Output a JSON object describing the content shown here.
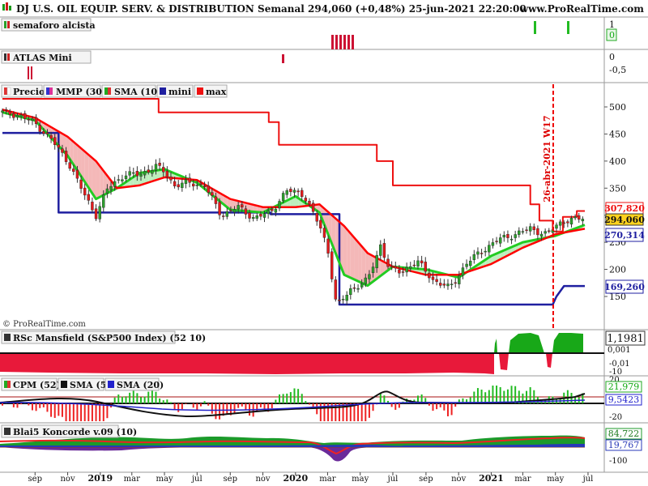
{
  "header": {
    "title": "DJ U.S. OIL EQUIP. SERV. & DISTRIBUTION Semanal 294,060 (+0,48%) 25-jun-2021 22:20:00",
    "site": "www.ProRealTime.com"
  },
  "watermark": "© ProRealTime.com",
  "colors": {
    "candle_up": "#2ca02c",
    "candle_down": "#e41a1c",
    "mmp": "#ff0000",
    "sma": "#22cc22",
    "mini": "#1f1fa0",
    "max": "#ee1111",
    "fill_red": "#f4b8b8",
    "fill_green": "#bdeebd",
    "mansfield_red": "#e8193a",
    "mansfield_green": "#18a818",
    "vline": "#ee0000"
  },
  "chart_data": [
    {
      "id": "semaforo",
      "type": "bar",
      "title": "semaforo alcista",
      "ylim": [
        0,
        1
      ],
      "yticks": [
        "1",
        "0"
      ],
      "current_label": "0",
      "green_signals": [
        "2021-03-15",
        "2021-05-10"
      ],
      "red_signals_panel_atlas": [
        "2020-01-27",
        "2020-02-10",
        "2020-02-24",
        "2020-03-09",
        "2020-03-23",
        "2020-04-06"
      ]
    },
    {
      "id": "atlas",
      "type": "bar",
      "title": "ATLAS Mini",
      "yticks": [
        "0",
        "-0,5"
      ],
      "red_bars": [
        "2018-08-06",
        "2018-08-13",
        "2019-11-25"
      ]
    },
    {
      "id": "price",
      "type": "line",
      "legend": [
        "Precio",
        "MMP (30)",
        "SMA (10)",
        "mini",
        "max"
      ],
      "ylim": [
        110,
        540
      ],
      "yticks": [
        500,
        450,
        400,
        350,
        300,
        250,
        200,
        150
      ],
      "x_ticks": [
        "sep",
        "nov",
        "2019",
        "mar",
        "may",
        "jul",
        "sep",
        "nov",
        "2020",
        "mar",
        "may",
        "jul",
        "sep",
        "nov",
        "2021",
        "mar",
        "may",
        "jul"
      ],
      "value_labels": [
        "307,820",
        "294,060",
        "270,314",
        "169,260"
      ],
      "vline": {
        "date": "2021-04-26",
        "label": "26-abr-2021 W17"
      },
      "close": [
        [
          "2018-07-02",
          490
        ],
        [
          "2018-08-01",
          485
        ],
        [
          "2018-09-01",
          470
        ],
        [
          "2018-10-01",
          440
        ],
        [
          "2018-11-01",
          400
        ],
        [
          "2018-12-01",
          340
        ],
        [
          "2018-12-24",
          300
        ],
        [
          "2019-01-15",
          350
        ],
        [
          "2019-02-15",
          375
        ],
        [
          "2019-03-15",
          375
        ],
        [
          "2019-04-15",
          390
        ],
        [
          "2019-05-01",
          380
        ],
        [
          "2019-05-20",
          355
        ],
        [
          "2019-06-15",
          360
        ],
        [
          "2019-07-15",
          355
        ],
        [
          "2019-08-15",
          300
        ],
        [
          "2019-09-15",
          315
        ],
        [
          "2019-10-15",
          295
        ],
        [
          "2019-11-15",
          305
        ],
        [
          "2019-12-15",
          345
        ],
        [
          "2020-01-15",
          340
        ],
        [
          "2020-02-15",
          280
        ],
        [
          "2020-03-01",
          240
        ],
        [
          "2020-03-18",
          130
        ],
        [
          "2020-04-15",
          165
        ],
        [
          "2020-05-15",
          180
        ],
        [
          "2020-06-08",
          245
        ],
        [
          "2020-06-25",
          200
        ],
        [
          "2020-07-15",
          195
        ],
        [
          "2020-08-15",
          215
        ],
        [
          "2020-09-15",
          180
        ],
        [
          "2020-10-15",
          165
        ],
        [
          "2020-11-15",
          210
        ],
        [
          "2020-12-15",
          235
        ],
        [
          "2021-01-15",
          255
        ],
        [
          "2021-02-15",
          265
        ],
        [
          "2021-03-15",
          275
        ],
        [
          "2021-04-15",
          265
        ],
        [
          "2021-05-15",
          290
        ],
        [
          "2021-06-25",
          294.06
        ]
      ],
      "mmp": [
        [
          "2018-07-02",
          495
        ],
        [
          "2018-09-01",
          480
        ],
        [
          "2018-11-01",
          445
        ],
        [
          "2018-12-24",
          400
        ],
        [
          "2019-02-01",
          350
        ],
        [
          "2019-03-15",
          355
        ],
        [
          "2019-05-01",
          370
        ],
        [
          "2019-07-01",
          365
        ],
        [
          "2019-09-01",
          330
        ],
        [
          "2019-11-01",
          315
        ],
        [
          "2020-01-01",
          315
        ],
        [
          "2020-02-15",
          320
        ],
        [
          "2020-04-01",
          280
        ],
        [
          "2020-05-15",
          230
        ],
        [
          "2020-07-01",
          205
        ],
        [
          "2020-09-01",
          190
        ],
        [
          "2020-11-01",
          190
        ],
        [
          "2021-01-01",
          210
        ],
        [
          "2021-03-01",
          240
        ],
        [
          "2021-05-01",
          265
        ],
        [
          "2021-06-25",
          275
        ]
      ],
      "sma": [
        [
          "2018-07-02",
          490
        ],
        [
          "2018-09-01",
          475
        ],
        [
          "2018-11-01",
          410
        ],
        [
          "2018-12-24",
          330
        ],
        [
          "2019-02-01",
          350
        ],
        [
          "2019-03-15",
          378
        ],
        [
          "2019-05-01",
          385
        ],
        [
          "2019-07-01",
          360
        ],
        [
          "2019-09-01",
          310
        ],
        [
          "2019-11-01",
          305
        ],
        [
          "2020-01-01",
          335
        ],
        [
          "2020-02-15",
          305
        ],
        [
          "2020-04-01",
          190
        ],
        [
          "2020-05-15",
          170
        ],
        [
          "2020-07-01",
          205
        ],
        [
          "2020-09-01",
          200
        ],
        [
          "2020-11-01",
          185
        ],
        [
          "2021-01-01",
          225
        ],
        [
          "2021-03-01",
          250
        ],
        [
          "2021-05-01",
          262
        ],
        [
          "2021-06-25",
          282
        ]
      ],
      "mini": [
        [
          "2018-07-02",
          452
        ],
        [
          "2018-10-15",
          452
        ],
        [
          "2018-10-15",
          305
        ],
        [
          "2019-11-15",
          305
        ],
        [
          "2019-11-15",
          302
        ],
        [
          "2020-03-23",
          302
        ],
        [
          "2020-03-23",
          135
        ],
        [
          "2021-04-26",
          135
        ],
        [
          "2021-05-03",
          150
        ],
        [
          "2021-05-17",
          169.26
        ],
        [
          "2021-06-25",
          169.26
        ]
      ],
      "max": [
        [
          "2018-07-02",
          515
        ],
        [
          "2019-04-15",
          515
        ],
        [
          "2019-04-20",
          490
        ],
        [
          "2019-11-10",
          490
        ],
        [
          "2019-11-12",
          472
        ],
        [
          "2019-12-01",
          430
        ],
        [
          "2020-05-10",
          430
        ],
        [
          "2020-06-01",
          400
        ],
        [
          "2020-07-01",
          355
        ],
        [
          "2021-01-25",
          355
        ],
        [
          "2021-03-15",
          320
        ],
        [
          "2021-04-01",
          290
        ],
        [
          "2021-04-26",
          270
        ],
        [
          "2021-05-15",
          297
        ],
        [
          "2021-06-10",
          307.82
        ],
        [
          "2021-06-25",
          307.82
        ]
      ]
    },
    {
      "id": "mansfield",
      "type": "area",
      "title": "RSc Mansfield (S&P500 Index) (52 10)",
      "yticks": [
        "0,001",
        "-0,01",
        "-10"
      ],
      "current_label": "1,1981"
    },
    {
      "id": "cpm",
      "type": "bar",
      "title": "CPM (52)",
      "legend": [
        "CPM (52)",
        "SMA (5)",
        "SMA (20)"
      ],
      "yticks": [
        "20",
        "-20"
      ],
      "value_labels": [
        "21,979",
        "9,5423"
      ]
    },
    {
      "id": "koncorde",
      "type": "area",
      "title": "Blai5 Koncorde v.09 (10)",
      "yticks": [
        "-100"
      ],
      "value_labels": [
        "84,722",
        "19,767"
      ]
    }
  ]
}
